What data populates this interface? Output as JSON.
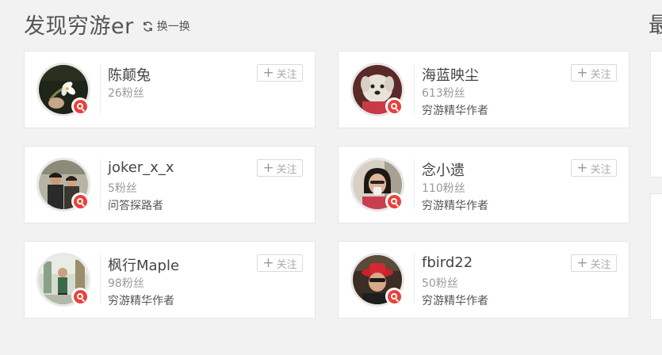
{
  "header": {
    "title": "发现穷游er",
    "refresh_label": "换一换",
    "right_title_fragment": "最"
  },
  "users": [
    {
      "name": "陈颠兔",
      "fans": "26粉丝",
      "tag": "",
      "follow_label": "关注",
      "avatar": "flower-photo-avatar",
      "badge": "qyer-logo-icon"
    },
    {
      "name": "海蓝映尘",
      "fans": "613粉丝",
      "tag": "穷游精华作者",
      "follow_label": "关注",
      "avatar": "dog-photo-avatar",
      "badge": "qyer-logo-icon"
    },
    {
      "name": "joker_x_x",
      "fans": "5粉丝",
      "tag": "问答探路者",
      "follow_label": "关注",
      "avatar": "couple-photo-avatar",
      "badge": "qyer-logo-icon"
    },
    {
      "name": "念小遗",
      "fans": "110粉丝",
      "tag": "穷游精华作者",
      "follow_label": "关注",
      "avatar": "woman-drinking-avatar",
      "badge": "qyer-logo-icon"
    },
    {
      "name": "枫行Maple",
      "fans": "98粉丝",
      "tag": "穷游精华作者",
      "follow_label": "关注",
      "avatar": "street-photo-avatar",
      "badge": "qyer-logo-icon"
    },
    {
      "name": "fbird22",
      "fans": "50粉丝",
      "tag": "穷游精华作者",
      "follow_label": "关注",
      "avatar": "man-red-hat-avatar",
      "badge": "qyer-logo-icon"
    }
  ],
  "colors": {
    "badge_red": "#e8423c",
    "background": "#f2f2f2",
    "card_border": "#e6e6e6"
  }
}
